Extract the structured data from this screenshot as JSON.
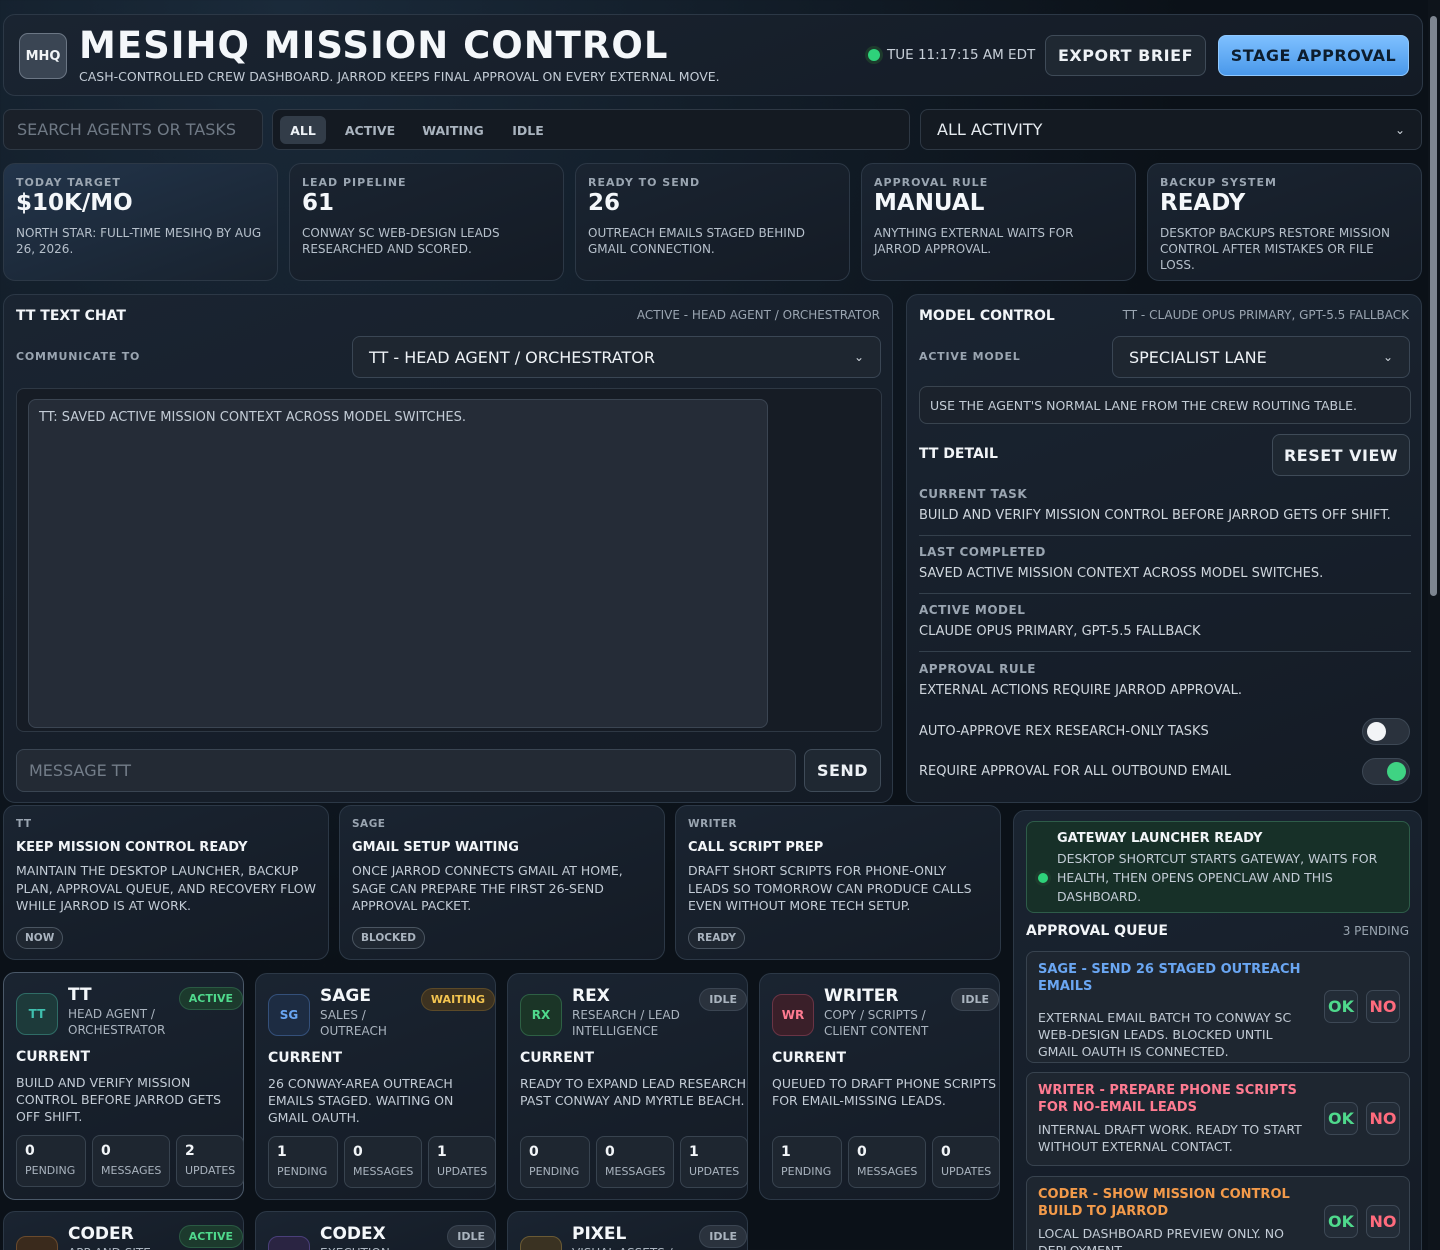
{
  "header": {
    "logo": "MHQ",
    "title": "MESIHQ MISSION CONTROL",
    "subtitle": "CASH-CONTROLLED CREW DASHBOARD. JARROD KEEPS FINAL APPROVAL ON EVERY EXTERNAL MOVE.",
    "clock": "TUE 11:17:15 AM EDT",
    "export_label": "EXPORT BRIEF",
    "stage_label": "STAGE APPROVAL",
    "accent_color": "#5aa8f0",
    "status_color": "#2ed27a"
  },
  "toolbar": {
    "search_placeholder": "SEARCH AGENTS OR TASKS",
    "filters": [
      "ALL",
      "ACTIVE",
      "WAITING",
      "IDLE"
    ],
    "selected_filter": "ALL",
    "activity_value": "ALL ACTIVITY"
  },
  "stats": [
    {
      "key": "TODAY TARGET",
      "value": "$10K/MO",
      "desc": "NORTH STAR: FULL-TIME MESIHQ BY AUG 26, 2026."
    },
    {
      "key": "LEAD PIPELINE",
      "value": "61",
      "desc": "CONWAY SC WEB-DESIGN LEADS RESEARCHED AND SCORED."
    },
    {
      "key": "READY TO SEND",
      "value": "26",
      "desc": "OUTREACH EMAILS STAGED BEHIND GMAIL CONNECTION."
    },
    {
      "key": "APPROVAL RULE",
      "value": "MANUAL",
      "desc": "ANYTHING EXTERNAL WAITS FOR JARROD APPROVAL."
    },
    {
      "key": "BACKUP SYSTEM",
      "value": "READY",
      "desc": "DESKTOP BACKUPS RESTORE MISSION CONTROL AFTER MISTAKES OR FILE LOSS."
    }
  ],
  "chat": {
    "title": "TT TEXT CHAT",
    "meta": "ACTIVE - HEAD AGENT / ORCHESTRATOR",
    "communicate_label": "COMMUNICATE TO",
    "communicate_value": "TT - HEAD AGENT / ORCHESTRATOR",
    "log": "TT: SAVED ACTIVE MISSION CONTEXT ACROSS MODEL SWITCHES.",
    "message_placeholder": "MESSAGE TT",
    "send_label": "SEND"
  },
  "model": {
    "title": "MODEL CONTROL",
    "meta": "TT - CLAUDE OPUS PRIMARY, GPT-5.5 FALLBACK",
    "active_label": "ACTIVE MODEL",
    "active_value": "SPECIALIST LANE",
    "note": "USE THE AGENT'S NORMAL LANE FROM THE CREW ROUTING TABLE.",
    "detail_title": "TT DETAIL",
    "reset_label": "RESET VIEW",
    "rows": [
      {
        "k": "CURRENT TASK",
        "v": "BUILD AND VERIFY MISSION CONTROL BEFORE JARROD GETS OFF SHIFT."
      },
      {
        "k": "LAST COMPLETED",
        "v": "SAVED ACTIVE MISSION CONTEXT ACROSS MODEL SWITCHES."
      },
      {
        "k": "ACTIVE MODEL",
        "v": "CLAUDE OPUS PRIMARY, GPT-5.5 FALLBACK"
      },
      {
        "k": "APPROVAL RULE",
        "v": "EXTERNAL ACTIONS REQUIRE JARROD APPROVAL."
      }
    ],
    "toggles": [
      {
        "label": "AUTO-APPROVE REX RESEARCH-ONLY TASKS",
        "on": false
      },
      {
        "label": "REQUIRE APPROVAL FOR ALL OUTBOUND EMAIL",
        "on": true
      }
    ]
  },
  "tasks": [
    {
      "owner": "TT",
      "title": "KEEP MISSION CONTROL READY",
      "desc": "MAINTAIN THE DESKTOP LAUNCHER, BACKUP PLAN, APPROVAL QUEUE, AND RECOVERY FLOW WHILE JARROD IS AT WORK.",
      "tag": "NOW"
    },
    {
      "owner": "SAGE",
      "title": "GMAIL SETUP WAITING",
      "desc": "ONCE JARROD CONNECTS GMAIL AT HOME, SAGE CAN PREPARE THE FIRST 26-SEND APPROVAL PACKET.",
      "tag": "BLOCKED"
    },
    {
      "owner": "WRITER",
      "title": "CALL SCRIPT PREP",
      "desc": "DRAFT SHORT SCRIPTS FOR PHONE-ONLY LEADS SO TOMORROW CAN PRODUCE CALLS EVEN WITHOUT MORE TECH SETUP.",
      "tag": "READY"
    }
  ],
  "agents": [
    {
      "initials": "TT",
      "name": "TT",
      "role": "HEAD AGENT / ORCHESTRATOR",
      "status": "ACTIVE",
      "current_label": "CURRENT",
      "current": "BUILD AND VERIFY MISSION CONTROL BEFORE JARROD GETS OFF SHIFT.",
      "pending": "0",
      "messages": "0",
      "updates": "2",
      "color": "#3fbfae"
    },
    {
      "initials": "SG",
      "name": "SAGE",
      "role": "SALES / OUTREACH",
      "status": "WAITING",
      "current_label": "CURRENT",
      "current": "26 CONWAY-AREA OUTREACH EMAILS STAGED. WAITING ON GMAIL OAUTH.",
      "pending": "1",
      "messages": "0",
      "updates": "1",
      "color": "#6aa6f2"
    },
    {
      "initials": "RX",
      "name": "REX",
      "role": "RESEARCH / LEAD INTELLIGENCE",
      "status": "IDLE",
      "current_label": "CURRENT",
      "current": "READY TO EXPAND LEAD RESEARCH PAST CONWAY AND MYRTLE BEACH.",
      "pending": "0",
      "messages": "0",
      "updates": "1",
      "color": "#4fd98c"
    },
    {
      "initials": "WR",
      "name": "WRITER",
      "role": "COPY / SCRIPTS / CLIENT CONTENT",
      "status": "IDLE",
      "current_label": "CURRENT",
      "current": "QUEUED TO DRAFT PHONE SCRIPTS FOR EMAIL-MISSING LEADS.",
      "pending": "1",
      "messages": "0",
      "updates": "0",
      "color": "#ff7b91"
    },
    {
      "initials": "CD",
      "name": "CODER",
      "role": "APP AND SITE",
      "status": "ACTIVE",
      "color": "#f39a4a"
    },
    {
      "initials": "CX",
      "name": "CODEX",
      "role": "EXECUTION",
      "status": "IDLE",
      "color": "#a58cf5"
    },
    {
      "initials": "PX",
      "name": "PIXEL",
      "role": "VISUAL ASSETS /",
      "status": "IDLE",
      "color": "#e8c06a"
    }
  ],
  "stat_labels": {
    "pending": "PENDING",
    "messages": "MESSAGES",
    "updates": "UPDATES"
  },
  "gateway": {
    "title": "GATEWAY LAUNCHER READY",
    "desc": "DESKTOP SHORTCUT STARTS GATEWAY, WAITS FOR HEALTH, THEN OPENS OPENCLAW AND THIS DASHBOARD."
  },
  "approval_queue": {
    "title": "APPROVAL QUEUE",
    "count": "3 PENDING",
    "ok_label": "OK",
    "no_label": "NO",
    "items": [
      {
        "title": "SAGE - SEND 26 STAGED OUTREACH EMAILS",
        "desc": "EXTERNAL EMAIL BATCH TO CONWAY SC WEB-DESIGN LEADS. BLOCKED UNTIL GMAIL OAUTH IS CONNECTED.",
        "color": "#6aa6f2"
      },
      {
        "title": "WRITER - PREPARE PHONE SCRIPTS FOR NO-EMAIL LEADS",
        "desc": "INTERNAL DRAFT WORK. READY TO START WITHOUT EXTERNAL CONTACT.",
        "color": "#ff7b91"
      },
      {
        "title": "CODER - SHOW MISSION CONTROL BUILD TO JARROD",
        "desc": "LOCAL DASHBOARD PREVIEW ONLY. NO DEPLOYMENT.",
        "color": "#f39a4a"
      }
    ]
  }
}
